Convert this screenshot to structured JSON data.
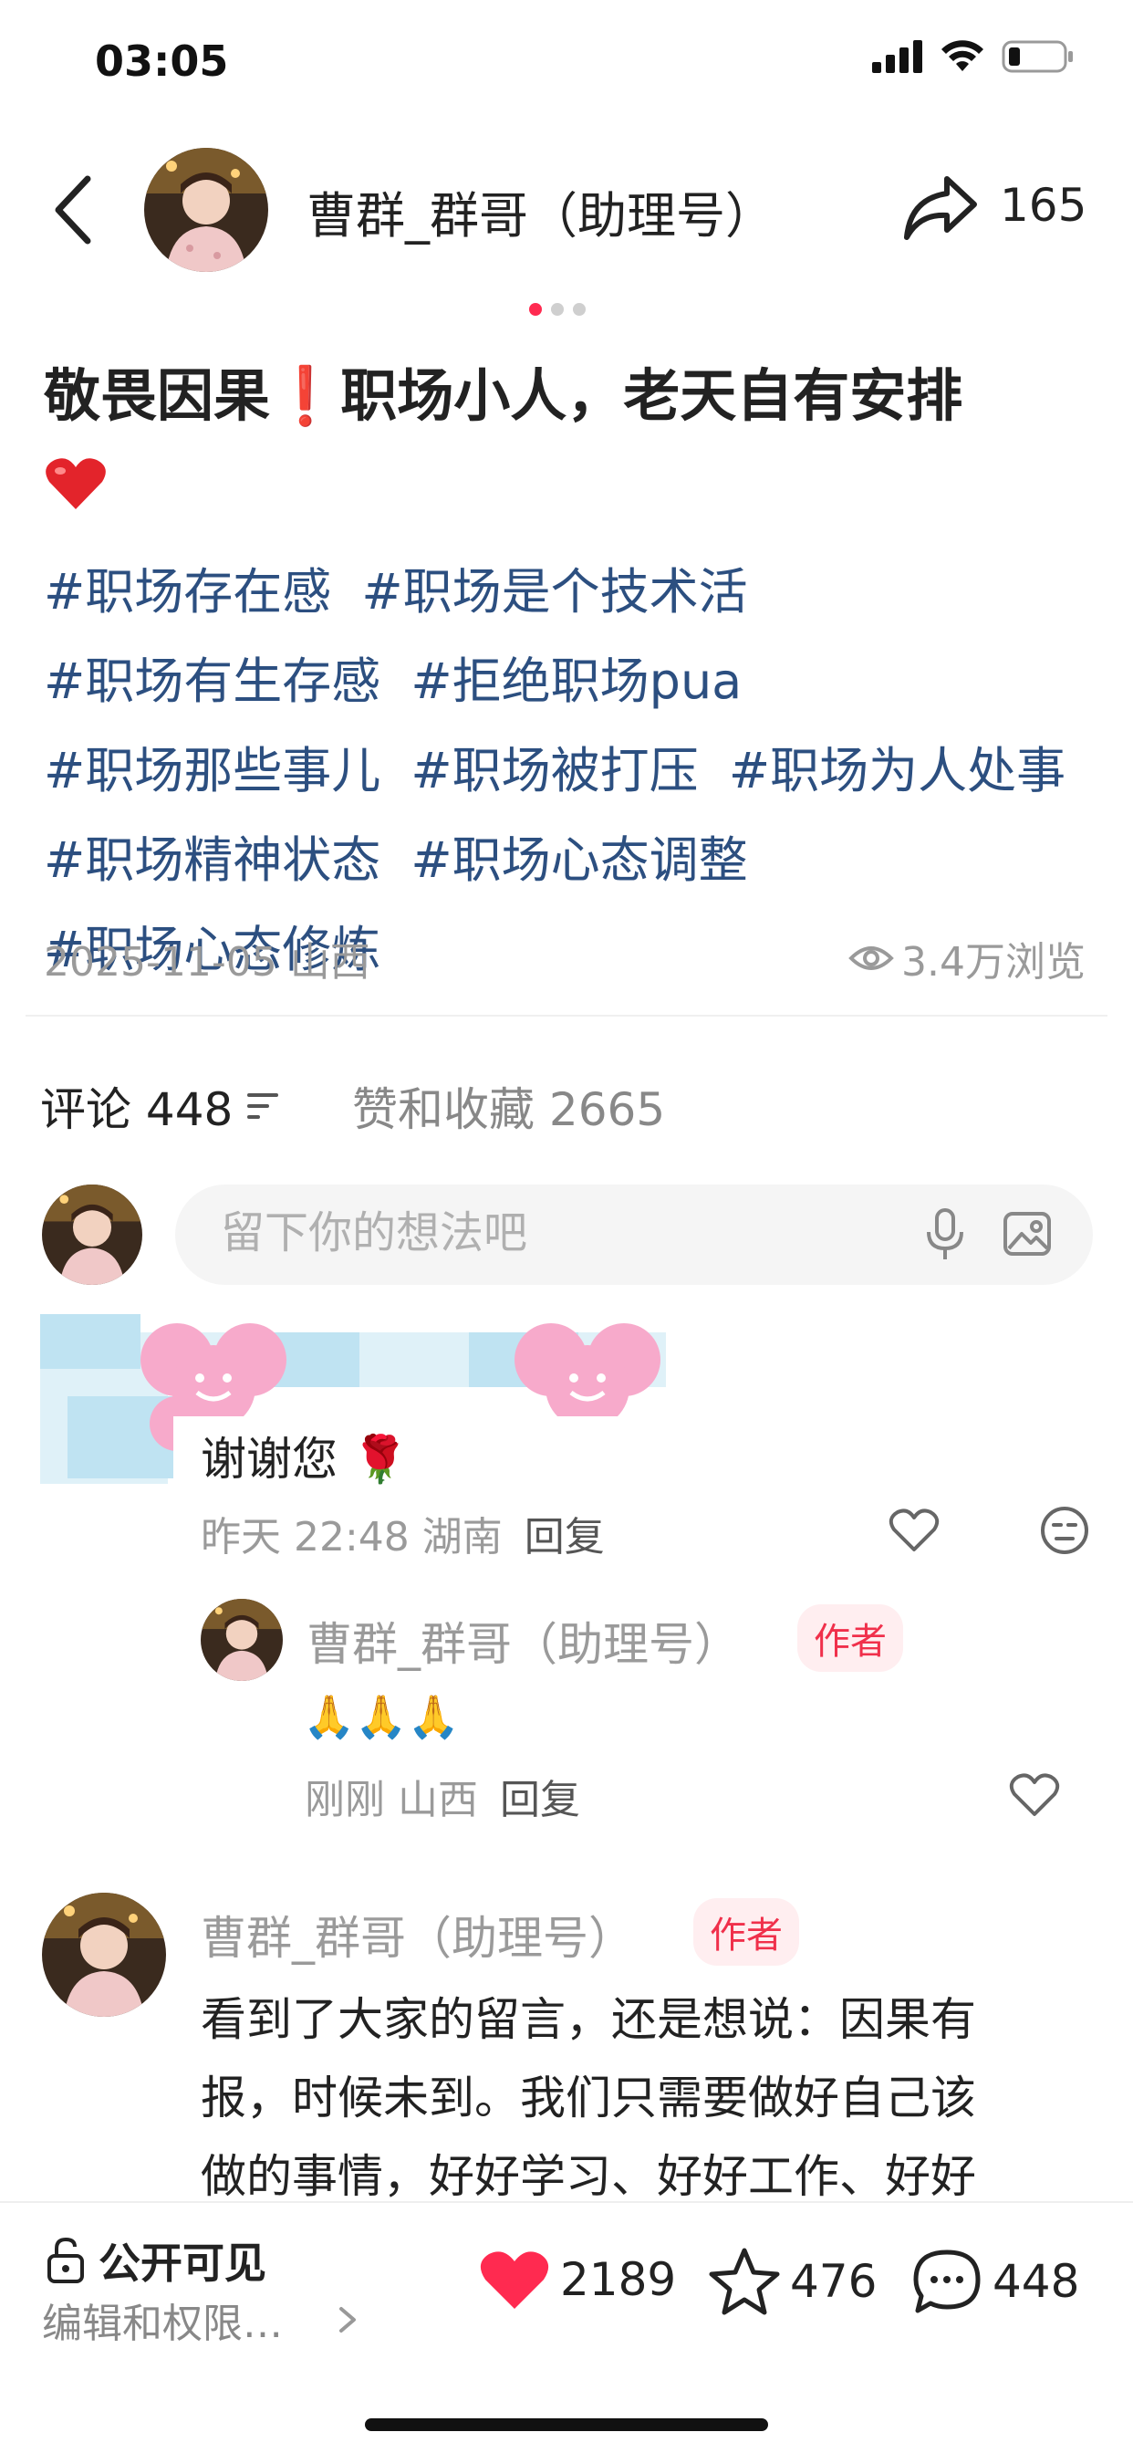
{
  "status_bar": {
    "time": "03:05"
  },
  "header": {
    "account_name": "曹群_群哥（助理号）",
    "share_count": "165"
  },
  "post": {
    "title_part1": "敬畏因果",
    "title_mark": "❗",
    "title_part2": "职场小人，老天自有安排",
    "tags": [
      "#职场存在感",
      "#职场是个技术活",
      "#职场有生存感",
      "#拒绝职场pua",
      "#职场那些事儿",
      "#职场被打压",
      "#职场为人处事",
      "#职场精神状态",
      "#职场心态调整",
      "#职场心态修炼"
    ],
    "date_location": "2025-11-05 山西",
    "views": "3.4万浏览"
  },
  "tabs": {
    "comments_label": "评论 448",
    "likes_label": "赞和收藏 2665"
  },
  "comment_input": {
    "placeholder": "留下你的想法吧"
  },
  "comments": {
    "first": {
      "text": "谢谢您 🌹",
      "time_location": "昨天 22:48 湖南",
      "reply": "回复"
    },
    "author_reply": {
      "name": "曹群_群哥（助理号）",
      "badge": "作者",
      "text": "🙏🙏🙏",
      "time_location": "刚刚 山西",
      "reply": "回复"
    },
    "second": {
      "name": "曹群_群哥（助理号）",
      "badge": "作者",
      "line1": "看到了大家的留言，还是想说：因果有",
      "line2": "报，时候未到。我们只需要做好自己该",
      "line3": "做的事情，好好学习、好好工作、好好"
    }
  },
  "bottom_bar": {
    "visibility": "公开可见",
    "edit_permissions": "编辑和权限…",
    "likes": "2189",
    "favorites": "476",
    "comments": "448"
  },
  "colors": {
    "accent": "#ff2a50",
    "tag": "#2c4f80",
    "muted": "#9a9a9a"
  }
}
